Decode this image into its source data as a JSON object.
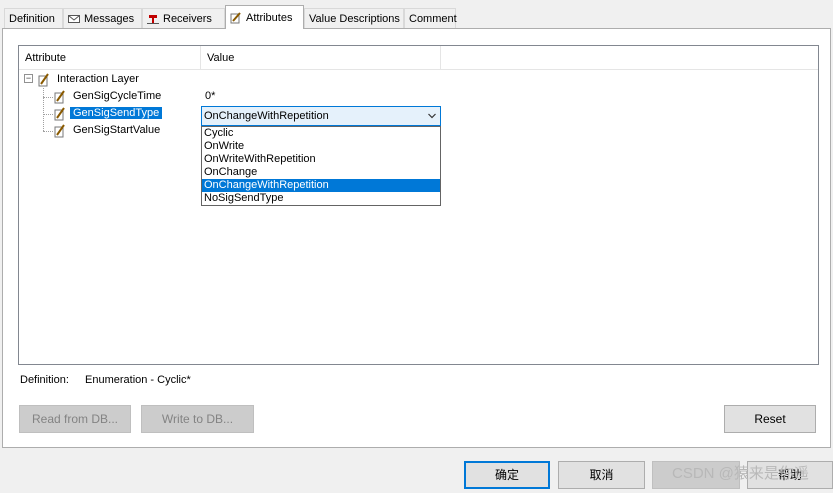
{
  "tabs": [
    {
      "label": "Definition",
      "icon": "none",
      "active": false
    },
    {
      "label": "Messages",
      "icon": "envelope-icon",
      "active": false
    },
    {
      "label": "Receivers",
      "icon": "receiver-pin-icon",
      "active": false
    },
    {
      "label": "Attributes",
      "icon": "pencil-page-icon",
      "active": true
    },
    {
      "label": "Value Descriptions",
      "icon": "none",
      "active": false
    },
    {
      "label": "Comment",
      "icon": "none",
      "active": false
    }
  ],
  "grid": {
    "columns": [
      "Attribute",
      "Value"
    ],
    "root": {
      "label": "Interaction Layer",
      "expander": "−"
    },
    "rows": [
      {
        "attribute": "GenSigCycleTime",
        "value": "0*"
      },
      {
        "attribute": "GenSigSendType",
        "value": "OnChangeWithRepetition",
        "selected": true
      },
      {
        "attribute": "GenSigStartValue",
        "value": ""
      }
    ]
  },
  "dropdown": {
    "current": "OnChangeWithRepetition",
    "options": [
      "Cyclic",
      "OnWrite",
      "OnWriteWithRepetition",
      "OnChange",
      "OnChangeWithRepetition",
      "NoSigSendType"
    ],
    "selected_index": 4
  },
  "definition": {
    "label": "Definition:",
    "value": "Enumeration - Cyclic*"
  },
  "buttons": {
    "read_from_db": "Read from DB...",
    "write_to_db": "Write to DB...",
    "reset": "Reset",
    "ok": "确定",
    "cancel": "取消",
    "help": "帮助"
  },
  "watermark": "CSDN @猿来是你遥",
  "colors": {
    "selection": "#0078d7",
    "panel_bg": "#ffffff",
    "window_bg": "#f0f0f0"
  }
}
